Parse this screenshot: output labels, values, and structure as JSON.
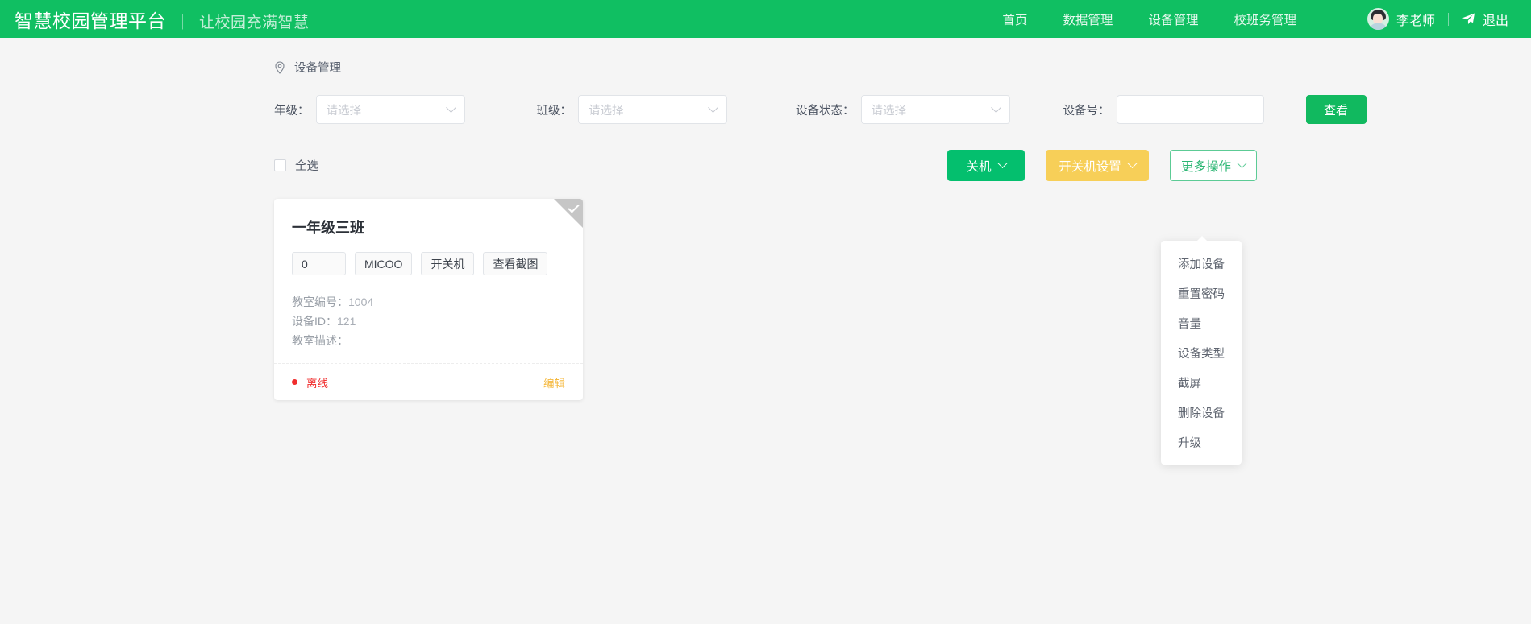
{
  "header": {
    "brand_main": "智慧校园管理平台",
    "brand_separator": "｜",
    "brand_sub": "让校园充满智慧",
    "nav": [
      {
        "label": "首页"
      },
      {
        "label": "数据管理"
      },
      {
        "label": "设备管理"
      },
      {
        "label": "校班务管理"
      }
    ],
    "user_name": "李老师",
    "logout_label": "退出",
    "avatar_icon": "user-avatar-icon",
    "send_icon": "paper-plane-icon",
    "bg_color": "#10bf62"
  },
  "breadcrumb": {
    "icon": "location-pin-icon",
    "label": "设备管理"
  },
  "filters": {
    "grade": {
      "label": "年级：",
      "placeholder": "请选择",
      "value": ""
    },
    "class": {
      "label": "班级：",
      "placeholder": "请选择",
      "value": ""
    },
    "status": {
      "label": "设备状态：",
      "placeholder": "请选择",
      "value": ""
    },
    "device_no": {
      "label": "设备号：",
      "placeholder": "",
      "value": ""
    },
    "search_button": "查看"
  },
  "toolbar": {
    "select_all_label": "全选",
    "select_all_checked": false,
    "shutdown_button": "关机",
    "power_settings_button": "开关机设置",
    "more_actions_button": "更多操作",
    "colors": {
      "green": "#04bf6e",
      "yellow": "#f7cf58",
      "outline": "#5ccb95"
    }
  },
  "dropdown": {
    "open": true,
    "items": [
      {
        "label": "添加设备"
      },
      {
        "label": "重置密码"
      },
      {
        "label": "音量"
      },
      {
        "label": "设备类型"
      },
      {
        "label": "截屏"
      },
      {
        "label": "删除设备"
      },
      {
        "label": "升级"
      }
    ]
  },
  "cards": [
    {
      "title": "一年级三班",
      "tags": [
        {
          "label": "0"
        },
        {
          "label": "MICOO"
        },
        {
          "label": "开关机"
        },
        {
          "label": "查看截图"
        }
      ],
      "meta": [
        {
          "key": "教室编号：",
          "value": "1004"
        },
        {
          "key": "设备ID：",
          "value": "121"
        },
        {
          "key": "教室描述：",
          "value": ""
        }
      ],
      "status_text": "离线",
      "status_color": "#f02d2d",
      "edit_label": "编辑",
      "selected": false
    }
  ]
}
